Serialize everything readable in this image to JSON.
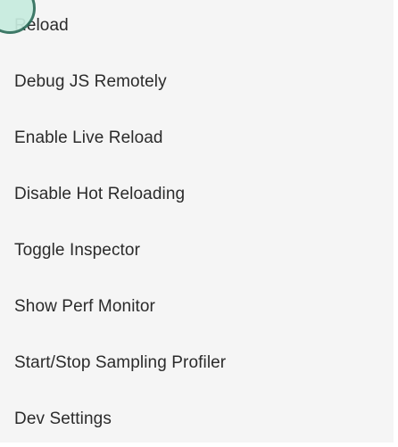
{
  "dev_menu": {
    "items": [
      {
        "label": "Reload"
      },
      {
        "label": "Debug JS Remotely"
      },
      {
        "label": "Enable Live Reload"
      },
      {
        "label": "Disable Hot Reloading"
      },
      {
        "label": "Toggle Inspector"
      },
      {
        "label": "Show Perf Monitor"
      },
      {
        "label": "Start/Stop Sampling Profiler"
      },
      {
        "label": "Dev Settings"
      }
    ]
  },
  "colors": {
    "panel_background": "#f5f5f5",
    "text": "#2b2b2b",
    "touch_fill": "#c7ecdf",
    "touch_border": "#2f6f5c"
  }
}
